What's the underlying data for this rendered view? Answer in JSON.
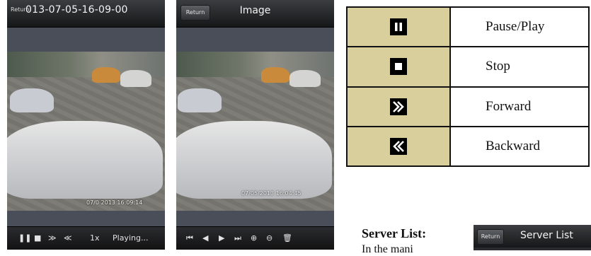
{
  "playback_screen": {
    "return_label": "Return",
    "title": "013-07-05-16-09-00",
    "video_timestamp": "07/0 2013 16:09:14",
    "controls": {
      "speed": "1x",
      "status": "Playing..."
    }
  },
  "image_screen": {
    "return_label": "Return",
    "title": "Image",
    "video_timestamp": "07/05/2013 16:04:45"
  },
  "legend_table": {
    "rows": [
      {
        "icon": "pause-icon",
        "label": "Pause/Play"
      },
      {
        "icon": "stop-icon",
        "label": "Stop"
      },
      {
        "icon": "forward-icon",
        "label": "Forward"
      },
      {
        "icon": "backward-icon",
        "label": "Backward"
      }
    ]
  },
  "section": {
    "heading": "Server List:",
    "body_fragment": "In the mani"
  },
  "server_list_screen": {
    "return_label": "Return",
    "title": "Server List"
  },
  "colors": {
    "legend_icon_cell": "#d8cf9d",
    "phone_background": "#4a4e58",
    "topbar": "#1f2022"
  }
}
